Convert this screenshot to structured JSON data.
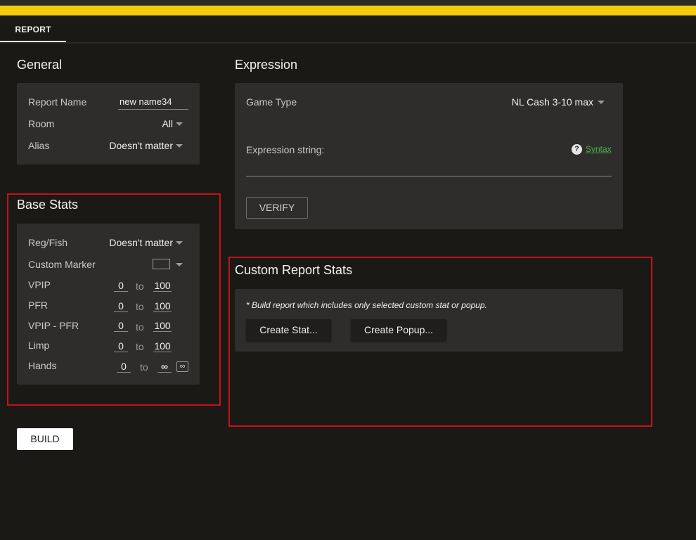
{
  "tabs": {
    "report": "REPORT"
  },
  "general": {
    "title": "General",
    "report_name_label": "Report Name",
    "report_name_value": "new name34",
    "room_label": "Room",
    "room_value": "All",
    "alias_label": "Alias",
    "alias_value": "Doesn't matter"
  },
  "base_stats": {
    "title": "Base Stats",
    "regfish_label": "Reg/Fish",
    "regfish_value": "Doesn't matter",
    "custom_marker_label": "Custom Marker",
    "to_label": "to",
    "rows": [
      {
        "label": "VPIP",
        "min": "0",
        "max": "100"
      },
      {
        "label": "PFR",
        "min": "0",
        "max": "100"
      },
      {
        "label": "VPIP - PFR",
        "min": "0",
        "max": "100"
      },
      {
        "label": "Limp",
        "min": "0",
        "max": "100"
      },
      {
        "label": "Hands",
        "min": "0",
        "max": "∞"
      }
    ],
    "infinity_icon": "∞"
  },
  "expression": {
    "title": "Expression",
    "game_type_label": "Game Type",
    "game_type_value": "NL Cash 3-10 max",
    "expression_string_label": "Expression string:",
    "syntax_link": "Syntax",
    "help_icon": "?",
    "verify_button": "VERIFY"
  },
  "custom_report_stats": {
    "title": "Custom Report Stats",
    "note": "* Build report which includes only selected custom stat or popup.",
    "create_stat_button": "Create Stat...",
    "create_popup_button": "Create Popup..."
  },
  "build_button": "BUILD",
  "colors": {
    "accent_yellow": "#f2cb0c",
    "highlight_red": "#c41218",
    "link_green": "#4caf50",
    "background": "#1b1915",
    "panel": "#2e2d2b"
  }
}
